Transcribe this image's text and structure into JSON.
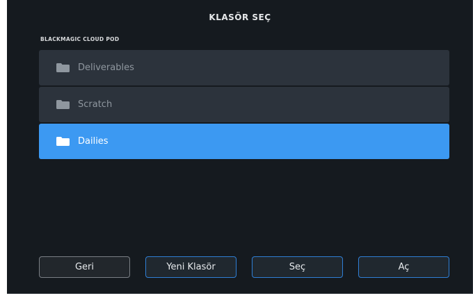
{
  "dialog": {
    "title": "KLASÖR SEÇ",
    "section_label": "BLACKMAGIC CLOUD POD"
  },
  "folders": [
    {
      "label": "Deliverables",
      "icon": "folder-icon",
      "selected": false
    },
    {
      "label": "Scratch",
      "icon": "folder-icon",
      "selected": false
    },
    {
      "label": "Dailies",
      "icon": "folder-icon",
      "selected": true
    }
  ],
  "buttons": {
    "back": "Geri",
    "new_folder": "Yeni Klasör",
    "select": "Seç",
    "open": "Aç"
  },
  "colors": {
    "background": "#151a1f",
    "row": "#2c333c",
    "selected_row": "#3c99f2",
    "button_border": "#2f7fd6"
  }
}
